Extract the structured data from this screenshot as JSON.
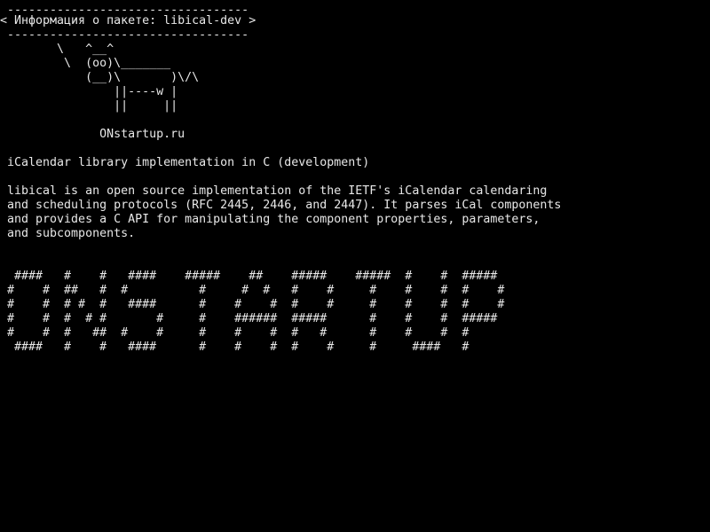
{
  "terminal": {
    "cow_border_top": " ----------------------------------",
    "cow_bubble": "< Информация о пакете: libical-dev >",
    "cow_border_bottom": " ----------------------------------",
    "cow_art": "        \\   ^__^\n         \\  (oo)\\_______\n            (__)\\       )\\/\\\n                ||----w |\n                ||     ||",
    "site": "              ONstartup.ru",
    "summary": " iCalendar library implementation in C (development)",
    "description": " libical is an open source implementation of the IETF's iCalendar calendaring\n and scheduling protocols (RFC 2445, 2446, and 2447). It parses iCal components\n and provides a C API for manipulating the component properties, parameters,\n and subcomponents.",
    "banner": "  ####   #    #   ####    #####    ##    #####    #####  #    #  #####\n #    #  ##   #  #          #     #  #   #    #     #    #    #  #    #\n #    #  # #  #   ####      #    #    #  #    #     #    #    #  #    #\n #    #  #  # #       #     #    ######  #####      #    #    #  #####\n #    #  #   ##  #    #     #    #    #  #   #      #    #    #  #\n  ####   #    #   ####      #    #    #  #    #     #     ####   #"
  }
}
